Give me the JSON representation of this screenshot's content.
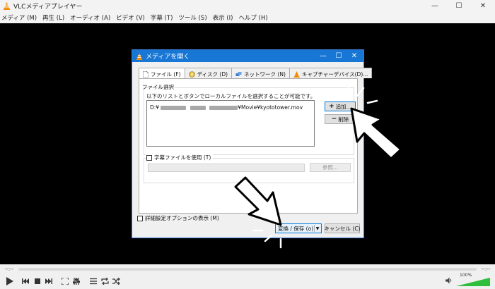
{
  "window": {
    "title": "VLCメディアプレイヤー",
    "controls": [
      "—",
      "☐",
      "✕"
    ]
  },
  "menu": [
    "メディア (M)",
    "再生 (L)",
    "オーディオ (A)",
    "ビデオ (V)",
    "字幕 (T)",
    "ツール (S)",
    "表示 (I)",
    "ヘルプ (H)"
  ],
  "seek": {
    "elapsed": "--:--",
    "remaining": "--:--"
  },
  "volume": {
    "percent": "100%",
    "level": 1.0
  },
  "dialog": {
    "title": "メディアを開く",
    "controls": [
      "—",
      "☐",
      "✕"
    ],
    "tabs": [
      "ファイル (F)",
      "ディスク (D)",
      "ネットワーク (N)",
      "キャプチャーデバイス(D)..."
    ],
    "file_selection": {
      "legend": "ファイル選択",
      "description": "以下のリストとボタンでローカルファイルを選択することが可能です。",
      "file_prefix": "D:¥",
      "file_suffix": "¥Movie¥kyototower.mov",
      "add_label": "追加...",
      "remove_label": "削除"
    },
    "subtitle": {
      "label": "字幕ファイルを使用 (T)",
      "browse_label": "参照..."
    },
    "show_options_label": "詳細設定オプションの表示 (M)",
    "convert_label": "変換 / 保存 (o)",
    "cancel_label": "キャンセル (C)"
  },
  "colors": {
    "accent": "#1877d4",
    "cone_orange": "#f28b00",
    "volume_green": "#2fbf3c"
  },
  "icons": {
    "play": "play-icon",
    "prev": "previous-icon",
    "stop": "stop-icon",
    "next": "next-icon",
    "fullscreen": "fullscreen-icon",
    "extended": "extended-settings-icon",
    "playlist": "playlist-icon",
    "loop": "loop-icon",
    "shuffle": "shuffle-icon",
    "volume": "volume-icon"
  }
}
